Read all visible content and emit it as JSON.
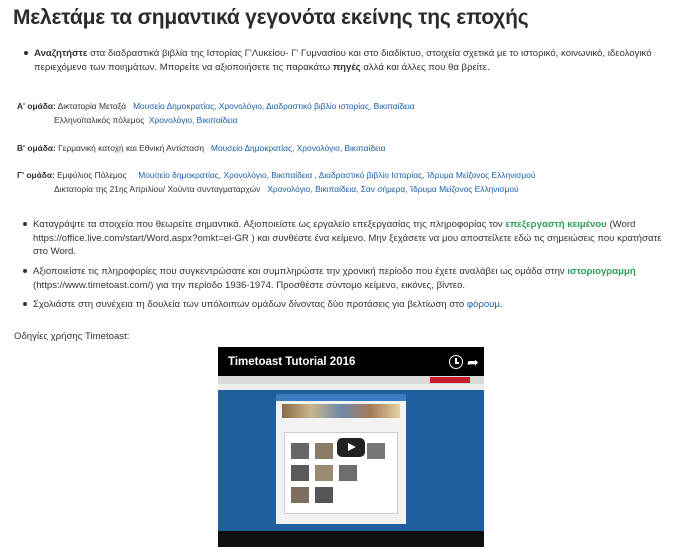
{
  "page_title": "Μελετάμε τα σημαντικά γεγονότα εκείνης της εποχής",
  "intro": {
    "lead_bold": "Αναζητήστε",
    "text1": " στα διαδραστικά βιβλία της Ιστορίας Γ'Λυκείου- Γ' Γυμνασίου και στο διαδίκτυο, στοιχεία σχετικά με το ιστορικό, κοινωνικό, ιδεολογικό περιεχόμενο των ποιημάτων. Μπορείτε να αξιοποιήσετε τις παρακάτω ",
    "sources_bold": "πηγές",
    "text2": " αλλά και άλλες που θα βρείτε."
  },
  "groups": {
    "a": {
      "label": "Α' ομάδα:",
      "topic1": "Δικτατορία Μεταξά",
      "links1": "Μουσείο Δημοκρατίας, Χρονολόγιο, Διαδραστικό βιβλίο ιστορίας, Βικιπαίδεια",
      "topic2": "Ελληνοϊταλικός πόλεμος",
      "links2": "Χρονολόγιο, Βικιπαίδεια"
    },
    "b": {
      "label": "Β' ομάδα:",
      "topic1": "Γερμανική κατοχή και Εθνική Αντίσταση",
      "links1": "Μουσείο Δημοκρατίας, Χρονολόγιο, Βικιπαίδεια"
    },
    "c": {
      "label": "Γ' ομάδα:",
      "topic1": "Εμφύλιος Πόλεμος",
      "links1": "Μουσείο δημοκρατίας, Χρονολόγιο, Βικιπαίδεια , Διαδραστικό βιβλίο Ιστορίας, Ίδρυμα Μείζονος Ελληνισμού",
      "topic2": "Δικτατορία της 21ης Απριλίου/ Χούντα συνταγματαρχών",
      "links2": "Χρονολόγιο, Βικιπαίδεια, Σαν σήμερα, Ίδρυμα Μείζονος Ελληνισμού"
    }
  },
  "tasks": {
    "t1_a": "Καταγράψτε τα στοιχεία που θεωρείτε σημαντικά. Αξιοποιείστε  ως εργαλείο επεξεργασίας της πληροφορίας τον ",
    "t1_link": "επεξεργαστή κειμένου",
    "t1_b": " (Word https://office.live.com/start/Word.aspx?omkt=el-GR ) και συνθέστε ένα κείμενο. Μην ξεχάσετε να μου αποστείλετε εδώ τις σημειώσεις που κρατήσατε στο Word.",
    "t2_a": "Αξιοποιείστε τις πληροφορίες που συγκεντρώσατε και συμπληρώστε την χρονική περίοδο που έχετε αναλάβει ως ομάδα στην ",
    "t2_link": "ιστοριογραμμή",
    "t2_b": " (https://www.timetoast.com/) για την περίοδο 1936-1974. Προσθέστε σύντομο κείμενο, εικόνες, βίντεο.",
    "t3_a": "Σχολιάστε στη συνέχεια τη δουλεία των υπόλοιπων ομάδων δίνοντας δύο προτάσεις για βελτίωση στο ",
    "t3_link": "φόρουμ",
    "t3_b": "."
  },
  "guide_label": "Οδηγίες χρήσης Timetoast:",
  "video": {
    "title": "Timetoast Tutorial 2016",
    "icons": [
      "clock-icon",
      "share-icon",
      "play-icon"
    ]
  }
}
